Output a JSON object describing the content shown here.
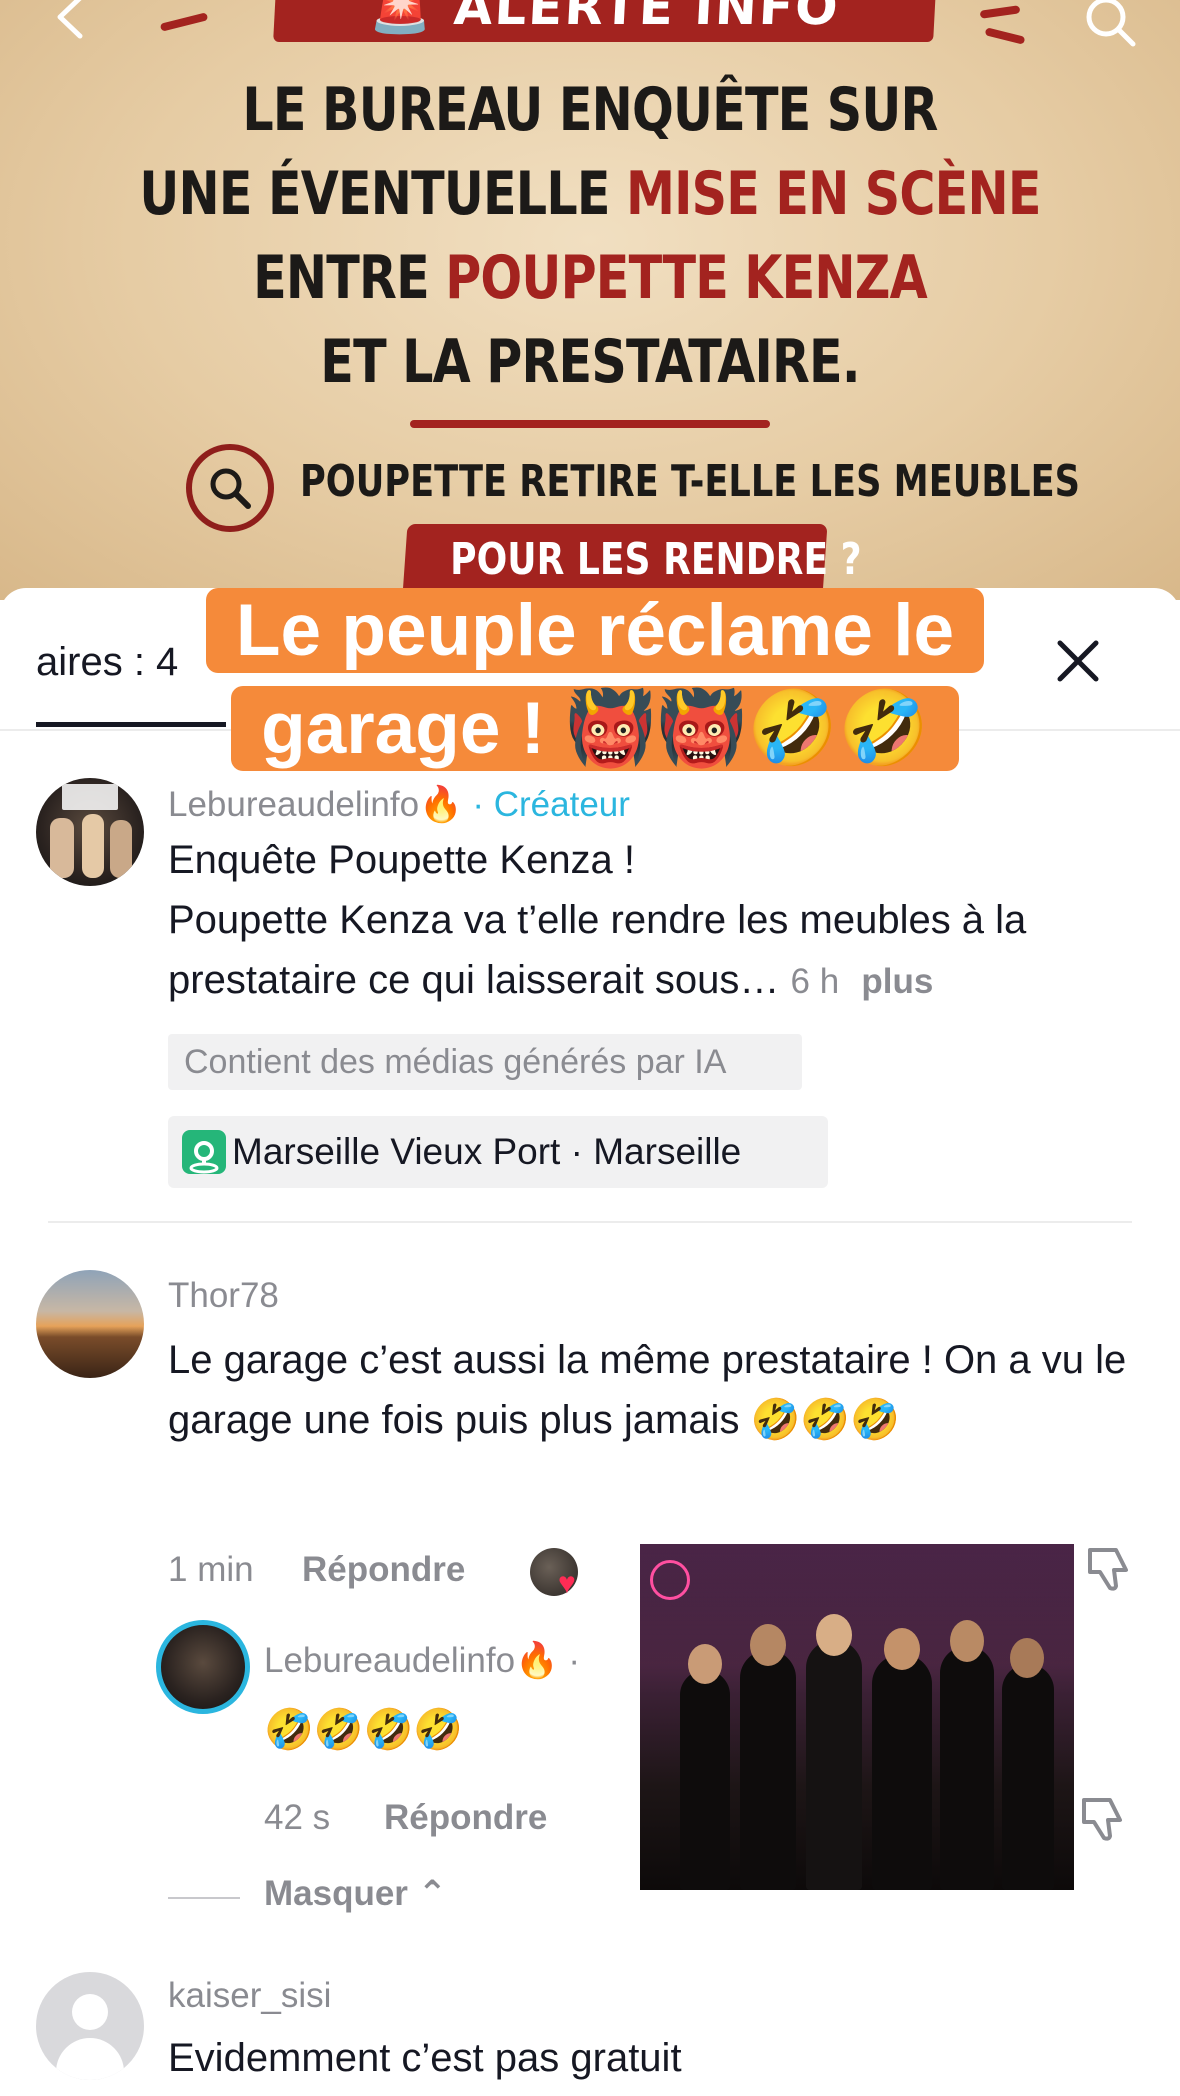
{
  "preview": {
    "alert_banner": "🚨 ALERTE INFO",
    "headline_line1": "LE BUREAU ENQUÊTE SUR",
    "headline_line2_plain": "UNE ÉVENTUELLE ",
    "headline_line2_red": "MISE EN SCÈNE",
    "headline_line3_plain": "ENTRE ",
    "headline_line3_red": "POUPETTE KENZA",
    "headline_line4": "ET LA PRESTATAIRE.",
    "question_line": "POUPETTE RETIRE T-ELLE LES MEUBLES",
    "question_pill": "POUR LES RENDRE ?",
    "colors": {
      "poster_red": "#a3231f",
      "caption_orange": "#f58a3a"
    },
    "icons": [
      "back-arrow-icon",
      "search-icon",
      "magnifier-icon"
    ]
  },
  "sheet": {
    "tab_label": "aires : 4",
    "overlay_caption": "Le peuple réclame le garage ! 👹👹🤣🤣",
    "close_icon": "close-icon"
  },
  "comments": [
    {
      "username": "Lebureaudelinfo🔥",
      "creator_tag": " · Créateur",
      "title": "Enquête Poupette Kenza !",
      "text": "Poupette Kenza va t’elle rendre les meubles à la prestataire ce qui laisserait sous…",
      "time": "6 h",
      "more": "plus",
      "ai_tag": "Contient des médias générés par IA",
      "location": "Marseille Vieux Port · Marseille"
    },
    {
      "username": "Thor78",
      "text": "Le garage c’est aussi la même prestataire ! On a vu le garage une fois puis plus jamais 🤣🤣🤣",
      "time": "1 min",
      "reply": "Répondre"
    }
  ],
  "reply": {
    "username": "Lebureaudelinfo🔥",
    "suffix": " ·",
    "text": "🤣🤣🤣🤣",
    "time": "42 s",
    "reply": "Répondre",
    "hide": "Masquer"
  },
  "next_comment": {
    "username": "kaiser_sisi",
    "text": "Evidemment c’est pas gratuit"
  }
}
